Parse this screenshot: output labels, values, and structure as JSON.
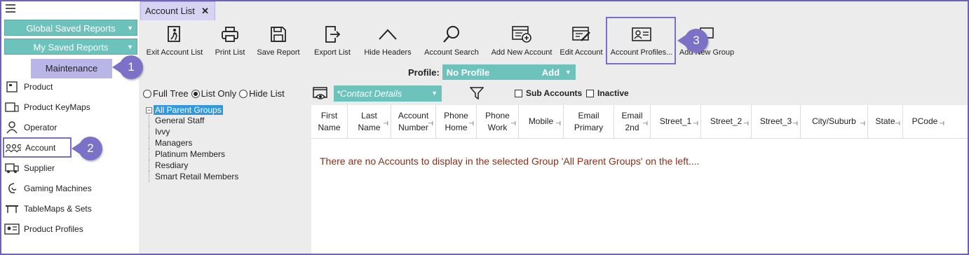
{
  "sidebar": {
    "global_saved_reports": "Global Saved Reports",
    "my_saved_reports": "My Saved Reports",
    "maintenance": "Maintenance",
    "items": [
      {
        "label": "Product",
        "icon": "product-icon"
      },
      {
        "label": "Product KeyMaps",
        "icon": "keymaps-icon"
      },
      {
        "label": "Operator",
        "icon": "operator-icon"
      },
      {
        "label": "Account",
        "icon": "account-icon"
      },
      {
        "label": "Supplier",
        "icon": "supplier-icon"
      },
      {
        "label": "Gaming Machines",
        "icon": "gaming-icon"
      },
      {
        "label": "TableMaps & Sets",
        "icon": "table-icon"
      },
      {
        "label": "Product Profiles",
        "icon": "profiles-icon"
      }
    ]
  },
  "callouts": [
    "1",
    "2",
    "3"
  ],
  "tab": {
    "label": "Account List",
    "close": "✕"
  },
  "toolbar": [
    {
      "label": "Exit Account List",
      "icon": "exit-icon"
    },
    {
      "label": "Print List",
      "icon": "print-icon"
    },
    {
      "label": "Save Report",
      "icon": "save-icon"
    },
    {
      "label": "Export List",
      "icon": "export-icon"
    },
    {
      "label": "Hide Headers",
      "icon": "chevron-up-icon"
    },
    {
      "label": "Account Search",
      "icon": "search-icon"
    },
    {
      "label": "Add New Account",
      "icon": "add-account-icon"
    },
    {
      "label": "Edit Account",
      "icon": "edit-icon"
    },
    {
      "label": "Account Profiles...",
      "icon": "profile-card-icon"
    },
    {
      "label": "Add New Group",
      "icon": "group-icon"
    }
  ],
  "profile": {
    "label": "Profile:",
    "value": "No Profile",
    "add": "Add"
  },
  "view_options": {
    "full_tree": "Full Tree",
    "list_only": "List Only",
    "hide_list": "Hide List",
    "selected": "List Only"
  },
  "contact_details": "*Contact Details",
  "sub_accounts": "Sub Accounts",
  "inactive": "Inactive",
  "tree": {
    "root": "All Parent Groups",
    "children": [
      "General Staff",
      "Ivvy",
      "Managers",
      "Platinum Members",
      "Resdiary",
      "Smart Retail Members"
    ]
  },
  "columns": [
    {
      "l1": "First",
      "l2": "Name"
    },
    {
      "l1": "Last",
      "l2": "Name"
    },
    {
      "l1": "Account",
      "l2": "Number"
    },
    {
      "l1": "Phone",
      "l2": "Home"
    },
    {
      "l1": "Phone",
      "l2": "Work"
    },
    {
      "l1": "Mobile",
      "l2": ""
    },
    {
      "l1": "Email",
      "l2": "Primary"
    },
    {
      "l1": "Email",
      "l2": "2nd"
    },
    {
      "l1": "Street_1",
      "l2": ""
    },
    {
      "l1": "Street_2",
      "l2": ""
    },
    {
      "l1": "Street_3",
      "l2": ""
    },
    {
      "l1": "City/Suburb",
      "l2": ""
    },
    {
      "l1": "State",
      "l2": ""
    },
    {
      "l1": "PCode",
      "l2": ""
    }
  ],
  "empty_message": "There are no Accounts to display in the selected Group 'All Parent Groups' on the left....",
  "colors": {
    "teal": "#6dc2bc",
    "accent": "#7b72c8",
    "tab": "#d6d2f2",
    "message": "#8b2f1a"
  }
}
